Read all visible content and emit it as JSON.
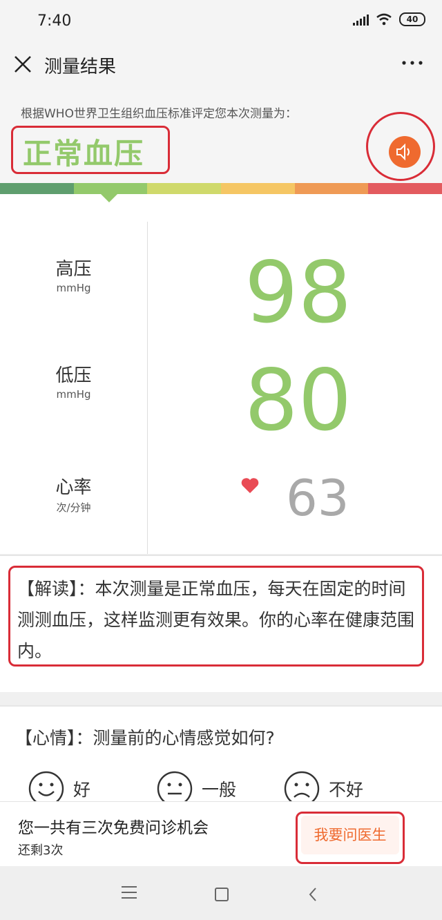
{
  "status_bar": {
    "time": "7:40",
    "battery": "40"
  },
  "nav": {
    "title": "测量结果"
  },
  "result": {
    "intro": "根据WHO世界卫生组织血压标准评定您本次测量为：",
    "status": "正常血压",
    "scale_colors": [
      "#5f9e6e",
      "#93c96b",
      "#cfd96b",
      "#f5c664",
      "#ef9a55",
      "#e35b5f"
    ]
  },
  "readings": {
    "systolic": {
      "label": "高压",
      "unit": "mmHg",
      "value": "98"
    },
    "diastolic": {
      "label": "低压",
      "unit": "mmHg",
      "value": "80"
    },
    "heart_rate": {
      "label": "心率",
      "unit": "次/分钟",
      "value": "63"
    }
  },
  "interpretation": {
    "text": "【解读】：本次测量是正常血压，每天在固定的时间测测血压，这样监测更有效果。你的心率在健康范围内。"
  },
  "mood": {
    "question": "【心情】：测量前的心情感觉如何?",
    "options": [
      {
        "label": "好",
        "icon": "happy-face-icon"
      },
      {
        "label": "一般",
        "icon": "neutral-face-icon"
      },
      {
        "label": "不好",
        "icon": "sad-face-icon"
      }
    ]
  },
  "consult": {
    "chance_text": "您一共有三次免费问诊机会",
    "remaining_text": "还剩3次",
    "ask_button": "我要问医生"
  },
  "colors": {
    "accent_green": "#93c96b",
    "accent_orange": "#ef6a2f",
    "highlight_red": "#d92c37"
  }
}
